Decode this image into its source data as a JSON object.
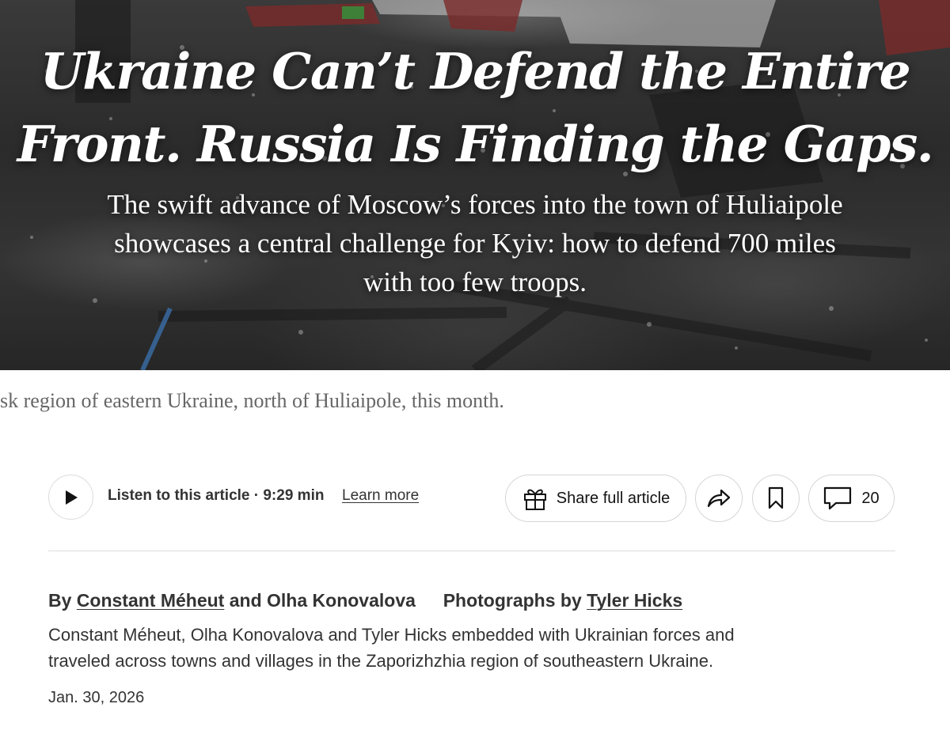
{
  "hero": {
    "headline_lines": [
      "Ukraine Can’t Defend the Entire",
      "Front. Russia Is Finding the Gaps."
    ],
    "dek_lines": [
      "The swift advance of Moscow’s forces into the town of Huliaipole",
      "showcases a central challenge for Kyiv: how to defend 700 miles",
      "with too few troops."
    ]
  },
  "caption": "sk region of eastern Ukraine, north of Huliaipole, this month.",
  "toolbar": {
    "play_icon": "play-icon",
    "listen_label": "Listen to this article · 9:29 min",
    "learn_more": "Learn more",
    "share_full_label": "Share full article",
    "gift_icon": "gift-icon",
    "share_icon": "share-arrow-icon",
    "bookmark_icon": "bookmark-icon",
    "comment_icon": "comment-icon",
    "comment_count": "20"
  },
  "byline": {
    "by": "By",
    "author1": "Constant Méheut",
    "and": "and",
    "author2": "Olha Konovalova",
    "photos_by": "Photographs by",
    "photographer": "Tyler Hicks",
    "blurb_lines": [
      "Constant Méheut, Olha Konovalova and Tyler Hicks embedded with Ukrainian forces and",
      "traveled across towns and villages in the Zaporizhzhia region of southeastern Ukraine."
    ],
    "date": "Jan. 30, 2026"
  },
  "colors": {
    "text": "#121212",
    "muted_text": "#666666",
    "border": "#dcdcdc",
    "hero_overlay": "#2b2b2b"
  }
}
